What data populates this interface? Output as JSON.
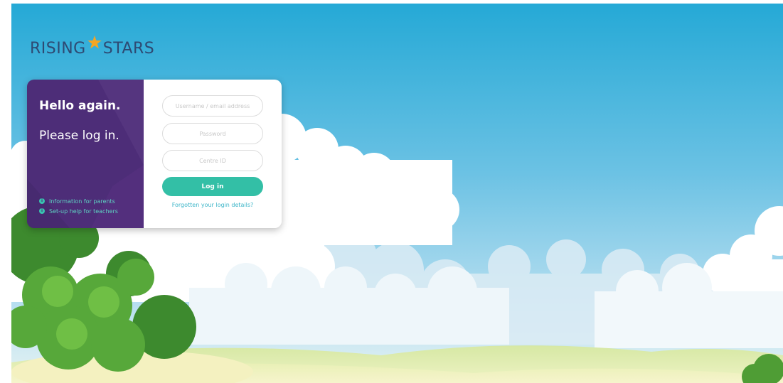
{
  "brand": {
    "name_part1": "RISING",
    "name_part2": "STARS",
    "colors": {
      "text": "#2e4a73",
      "star": "#f5a623"
    }
  },
  "login_panel": {
    "greeting": "Hello again.",
    "prompt": "Please log in.",
    "links": [
      {
        "label": "Information for parents",
        "icon": "info-icon"
      },
      {
        "label": "Set-up help for teachers",
        "icon": "info-icon"
      }
    ],
    "fields": {
      "username": {
        "placeholder": "Username / email address",
        "value": ""
      },
      "password": {
        "placeholder": "Password",
        "value": ""
      },
      "centre_id": {
        "placeholder": "Centre ID",
        "value": ""
      }
    },
    "submit_label": "Log in",
    "forgot_label": "Forgotten your login details?",
    "colors": {
      "panel": "#4d2d78",
      "accent": "#33bfa6",
      "link": "#3bb5c8"
    }
  }
}
